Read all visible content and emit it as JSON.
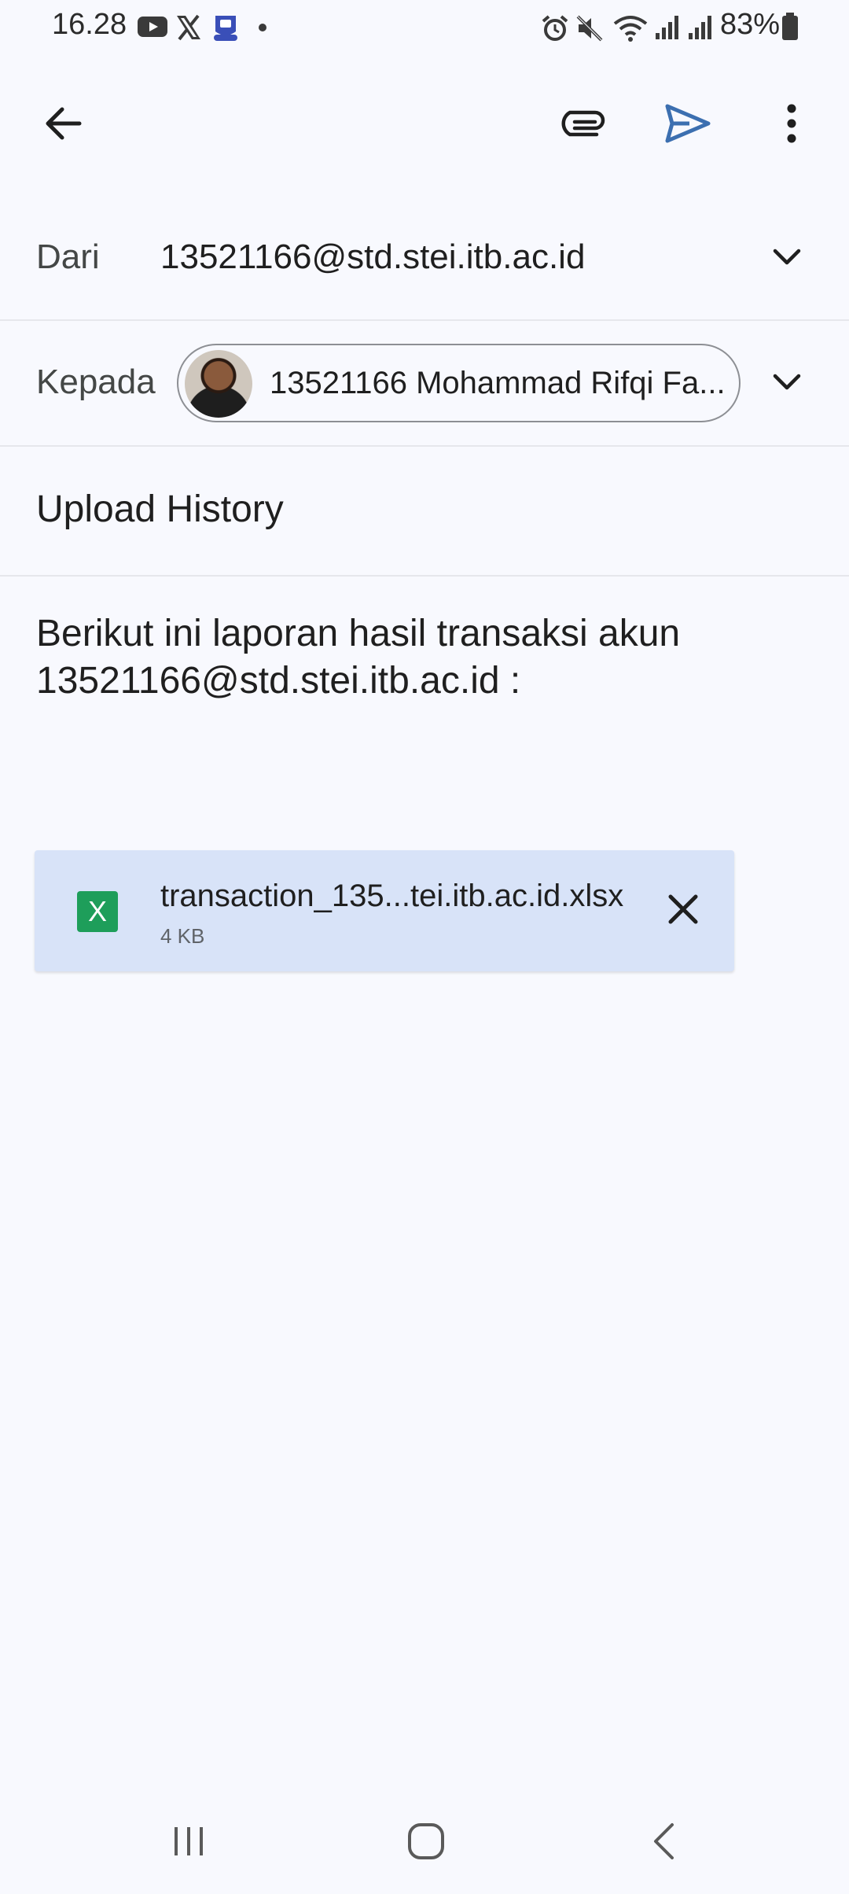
{
  "status_bar": {
    "time": "16.28",
    "battery": "83%",
    "icons": [
      "youtube-icon",
      "x-icon",
      "app-icon",
      "dot-icon",
      "alarm-icon",
      "mute-icon",
      "wifi-icon",
      "signal-icon",
      "signal-icon",
      "battery-icon"
    ]
  },
  "toolbar": {
    "icons": [
      "back-arrow-icon",
      "attach-icon",
      "send-icon",
      "more-vert-icon"
    ],
    "accent": "#3c6fb0"
  },
  "compose": {
    "from_label": "Dari",
    "from_value": "13521166@std.stei.itb.ac.id",
    "to_label": "Kepada",
    "to_chip": "13521166 Mohammad Rifqi Fa...",
    "subject": "Upload History",
    "body_line1": "Berikut ini laporan hasil transaksi akun",
    "body_line2": "13521166@std.stei.itb.ac.id :"
  },
  "attachment": {
    "type_letter": "X",
    "filename": "transaction_135...tei.itb.ac.id.xlsx",
    "size": "4 KB",
    "colors": {
      "background": "#d8e3f8",
      "excel": "#1e9e5a"
    }
  },
  "nav_bar": {
    "icons": [
      "recents-icon",
      "home-icon",
      "back-icon"
    ]
  }
}
